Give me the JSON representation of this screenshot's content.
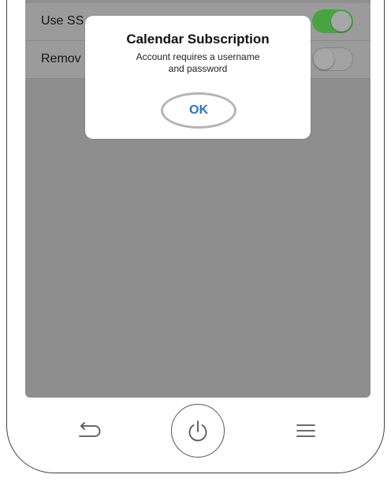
{
  "settings": {
    "rows": [
      {
        "label": "Use SS",
        "toggle": true
      },
      {
        "label": "Remov",
        "toggle": false
      }
    ]
  },
  "dialog": {
    "title": "Calendar Subscription",
    "message_line1": "Account requires a username",
    "message_line2": "and password",
    "ok_label": "OK"
  },
  "nav": {
    "back_icon": "back-arrow-icon",
    "power_icon": "power-icon",
    "menu_icon": "menu-icon"
  },
  "colors": {
    "accent_blue": "#1d73e8",
    "toggle_green": "#4aa343",
    "overlay_gray": "#8e8e8e"
  }
}
